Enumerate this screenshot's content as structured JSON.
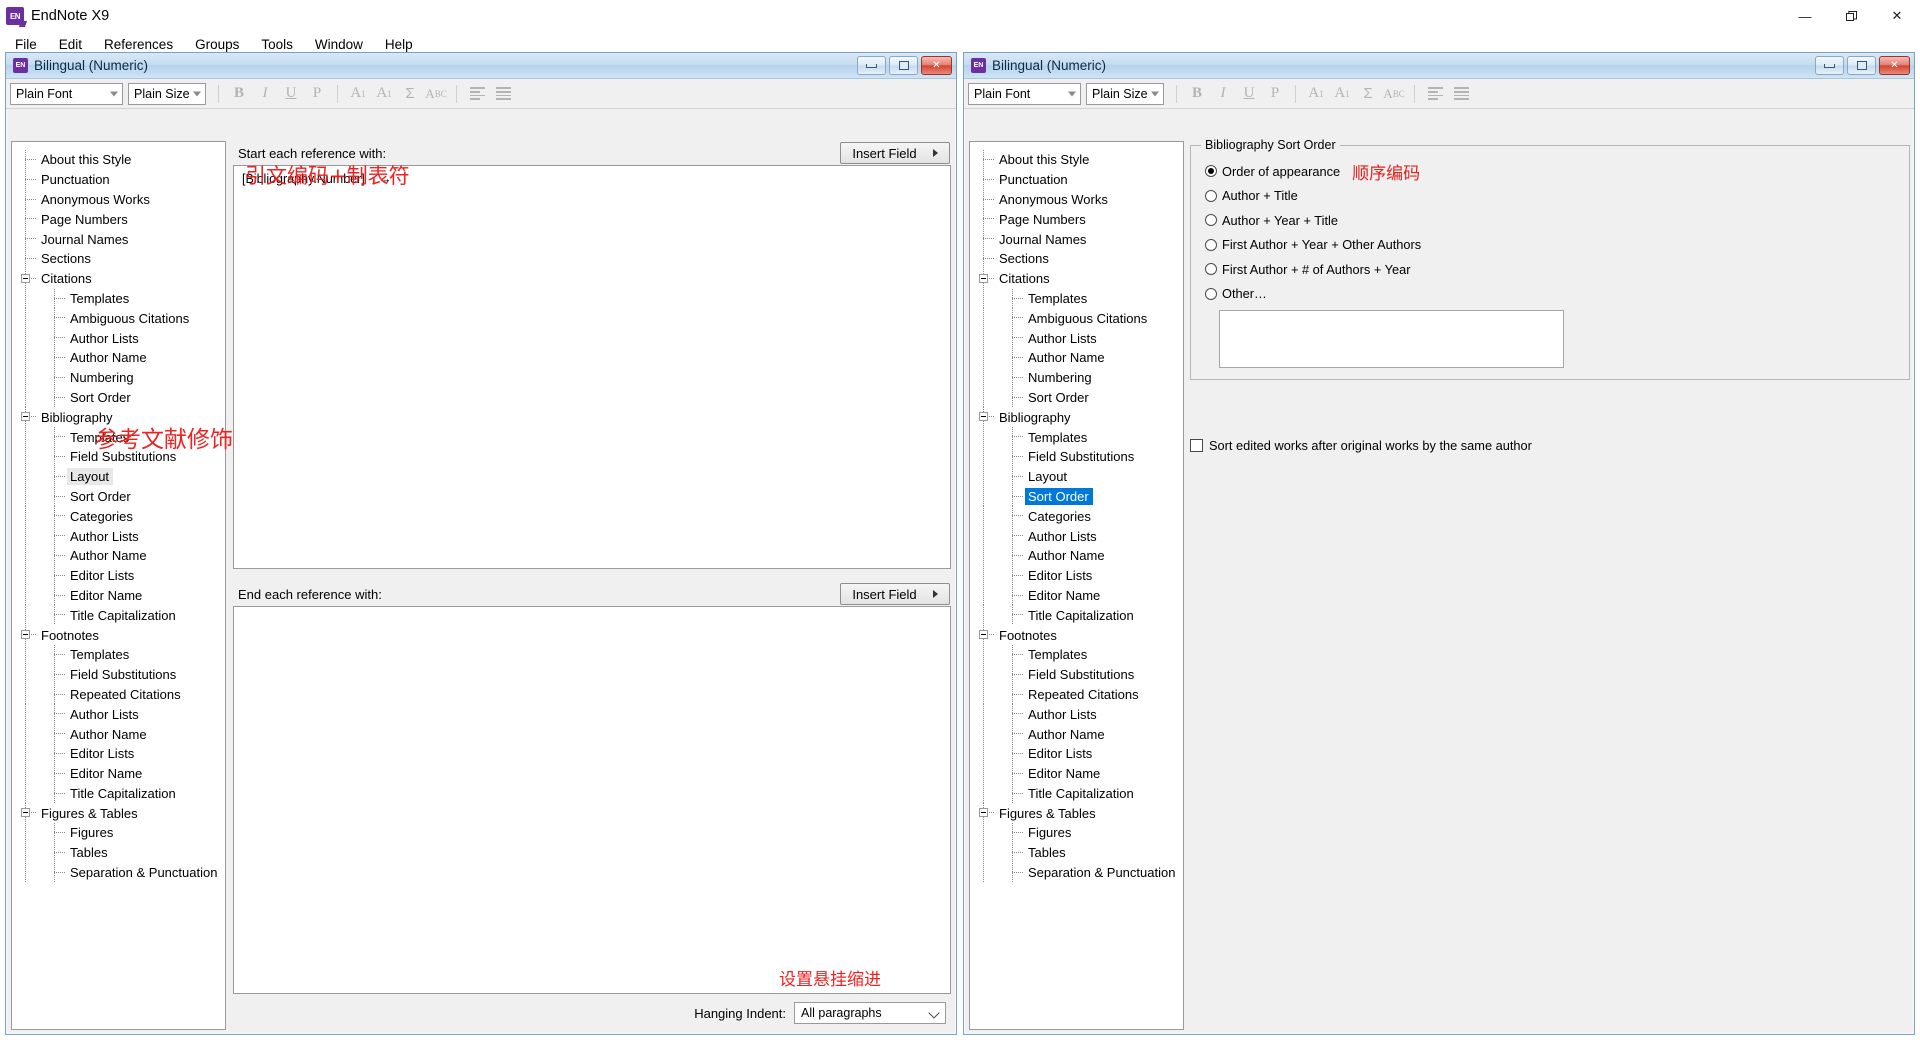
{
  "app": {
    "title": "EndNote X9",
    "icon": "endnote-icon",
    "window_controls": {
      "minimize": "—",
      "restore": "❐",
      "close": "✕"
    }
  },
  "menubar": {
    "items": [
      "File",
      "Edit",
      "References",
      "Groups",
      "Tools",
      "Window",
      "Help"
    ]
  },
  "toolbar": {
    "font_value": "Plain Font",
    "size_value": "Plain Size",
    "buttons": [
      "B",
      "I",
      "U",
      "P",
      "A1sup",
      "A1sub",
      "Sigma",
      "ABC",
      "align-left",
      "align-justify"
    ],
    "bold": "B",
    "italic": "I",
    "underline": "U",
    "plain": "P",
    "superscript": "A",
    "subscript": "A",
    "sigma": "Σ",
    "abc": "A"
  },
  "left_window": {
    "title": "Bilingual (Numeric)",
    "tree": [
      {
        "label": "About this Style",
        "level": 1,
        "expander": false
      },
      {
        "label": "Punctuation",
        "level": 1,
        "expander": false
      },
      {
        "label": "Anonymous Works",
        "level": 1,
        "expander": false
      },
      {
        "label": "Page Numbers",
        "level": 1,
        "expander": false
      },
      {
        "label": "Journal Names",
        "level": 1,
        "expander": false
      },
      {
        "label": "Sections",
        "level": 1,
        "expander": false
      },
      {
        "label": "Citations",
        "level": 1,
        "expander": true
      },
      {
        "label": "Templates",
        "level": 2,
        "expander": false
      },
      {
        "label": "Ambiguous Citations",
        "level": 2,
        "expander": false
      },
      {
        "label": "Author Lists",
        "level": 2,
        "expander": false
      },
      {
        "label": "Author Name",
        "level": 2,
        "expander": false
      },
      {
        "label": "Numbering",
        "level": 2,
        "expander": false
      },
      {
        "label": "Sort Order",
        "level": 2,
        "expander": false
      },
      {
        "label": "Bibliography",
        "level": 1,
        "expander": true
      },
      {
        "label": "Templates",
        "level": 2,
        "expander": false
      },
      {
        "label": "Field Substitutions",
        "level": 2,
        "expander": false
      },
      {
        "label": "Layout",
        "level": 2,
        "expander": false,
        "selected": "gray"
      },
      {
        "label": "Sort Order",
        "level": 2,
        "expander": false
      },
      {
        "label": "Categories",
        "level": 2,
        "expander": false
      },
      {
        "label": "Author Lists",
        "level": 2,
        "expander": false
      },
      {
        "label": "Author Name",
        "level": 2,
        "expander": false
      },
      {
        "label": "Editor Lists",
        "level": 2,
        "expander": false
      },
      {
        "label": "Editor Name",
        "level": 2,
        "expander": false
      },
      {
        "label": "Title Capitalization",
        "level": 2,
        "expander": false
      },
      {
        "label": "Footnotes",
        "level": 1,
        "expander": true
      },
      {
        "label": "Templates",
        "level": 2,
        "expander": false
      },
      {
        "label": "Field Substitutions",
        "level": 2,
        "expander": false
      },
      {
        "label": "Repeated Citations",
        "level": 2,
        "expander": false
      },
      {
        "label": "Author Lists",
        "level": 2,
        "expander": false
      },
      {
        "label": "Author Name",
        "level": 2,
        "expander": false
      },
      {
        "label": "Editor Lists",
        "level": 2,
        "expander": false
      },
      {
        "label": "Editor Name",
        "level": 2,
        "expander": false
      },
      {
        "label": "Title Capitalization",
        "level": 2,
        "expander": false
      },
      {
        "label": "Figures & Tables",
        "level": 1,
        "expander": true
      },
      {
        "label": "Figures",
        "level": 2,
        "expander": false
      },
      {
        "label": "Tables",
        "level": 2,
        "expander": false
      },
      {
        "label": "Separation & Punctuation",
        "level": 2,
        "expander": false
      }
    ],
    "start_label": "Start each reference with:",
    "end_label": "End each reference with:",
    "insert_field_label": "Insert Field",
    "start_value": "[Bibliography.Number]",
    "start_tab_glyph": "→",
    "end_value": "",
    "hanging_indent_label": "Hanging Indent:",
    "hanging_indent_value": "All paragraphs",
    "annotation_citation": "引文编码+制表符",
    "annotation_bibliography": "参考文献修饰",
    "annotation_hanging": "设置悬挂缩进"
  },
  "right_window": {
    "title": "Bilingual (Numeric)",
    "tree": [
      {
        "label": "About this Style",
        "level": 1,
        "expander": false
      },
      {
        "label": "Punctuation",
        "level": 1,
        "expander": false
      },
      {
        "label": "Anonymous Works",
        "level": 1,
        "expander": false
      },
      {
        "label": "Page Numbers",
        "level": 1,
        "expander": false
      },
      {
        "label": "Journal Names",
        "level": 1,
        "expander": false
      },
      {
        "label": "Sections",
        "level": 1,
        "expander": false
      },
      {
        "label": "Citations",
        "level": 1,
        "expander": true
      },
      {
        "label": "Templates",
        "level": 2,
        "expander": false
      },
      {
        "label": "Ambiguous Citations",
        "level": 2,
        "expander": false
      },
      {
        "label": "Author Lists",
        "level": 2,
        "expander": false
      },
      {
        "label": "Author Name",
        "level": 2,
        "expander": false
      },
      {
        "label": "Numbering",
        "level": 2,
        "expander": false
      },
      {
        "label": "Sort Order",
        "level": 2,
        "expander": false
      },
      {
        "label": "Bibliography",
        "level": 1,
        "expander": true
      },
      {
        "label": "Templates",
        "level": 2,
        "expander": false
      },
      {
        "label": "Field Substitutions",
        "level": 2,
        "expander": false
      },
      {
        "label": "Layout",
        "level": 2,
        "expander": false
      },
      {
        "label": "Sort Order",
        "level": 2,
        "expander": false,
        "selected": "blue"
      },
      {
        "label": "Categories",
        "level": 2,
        "expander": false
      },
      {
        "label": "Author Lists",
        "level": 2,
        "expander": false
      },
      {
        "label": "Author Name",
        "level": 2,
        "expander": false
      },
      {
        "label": "Editor Lists",
        "level": 2,
        "expander": false
      },
      {
        "label": "Editor Name",
        "level": 2,
        "expander": false
      },
      {
        "label": "Title Capitalization",
        "level": 2,
        "expander": false
      },
      {
        "label": "Footnotes",
        "level": 1,
        "expander": true
      },
      {
        "label": "Templates",
        "level": 2,
        "expander": false
      },
      {
        "label": "Field Substitutions",
        "level": 2,
        "expander": false
      },
      {
        "label": "Repeated Citations",
        "level": 2,
        "expander": false
      },
      {
        "label": "Author Lists",
        "level": 2,
        "expander": false
      },
      {
        "label": "Author Name",
        "level": 2,
        "expander": false
      },
      {
        "label": "Editor Lists",
        "level": 2,
        "expander": false
      },
      {
        "label": "Editor Name",
        "level": 2,
        "expander": false
      },
      {
        "label": "Title Capitalization",
        "level": 2,
        "expander": false
      },
      {
        "label": "Figures & Tables",
        "level": 1,
        "expander": true
      },
      {
        "label": "Figures",
        "level": 2,
        "expander": false
      },
      {
        "label": "Tables",
        "level": 2,
        "expander": false
      },
      {
        "label": "Separation & Punctuation",
        "level": 2,
        "expander": false
      }
    ],
    "group_title": "Bibliography Sort Order",
    "sort_options": [
      {
        "label": "Order of appearance",
        "checked": true,
        "note": "顺序编码"
      },
      {
        "label": "Author + Title",
        "checked": false
      },
      {
        "label": "Author + Year + Title",
        "checked": false
      },
      {
        "label": "First Author + Year + Other Authors",
        "checked": false
      },
      {
        "label": "First Author + # of Authors + Year",
        "checked": false
      },
      {
        "label": "Other…",
        "checked": false
      }
    ],
    "other_value": "",
    "checkbox_label": "Sort edited works after original works by the same author",
    "checkbox_checked": false
  },
  "colors": {
    "annotation_red": "#ef2222",
    "selection_blue": "#0078d7",
    "selection_gray": "#e8e8e8",
    "titlebar_blue": "#c6ddf1"
  }
}
